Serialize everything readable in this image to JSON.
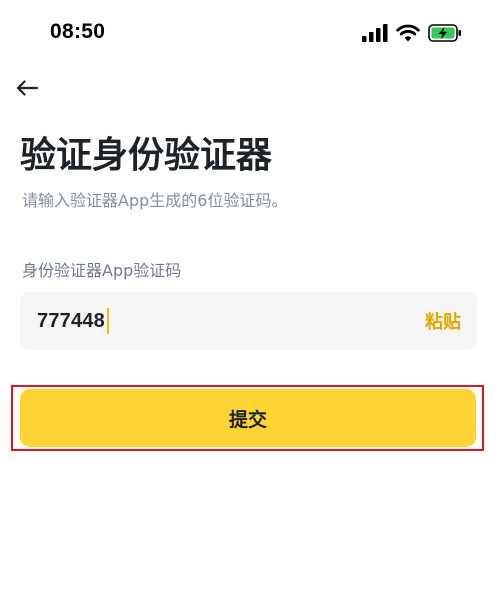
{
  "status_bar": {
    "time": "08:50",
    "icons": [
      "cellular-signal-icon",
      "wifi-icon",
      "battery-charging-icon"
    ],
    "battery_color": "#34c759"
  },
  "header": {
    "back_icon": "back-arrow-icon"
  },
  "main": {
    "title": "验证身份验证器",
    "subtitle": "请输入验证器App生成的6位验证码。",
    "field": {
      "label": "身份验证器App验证码",
      "value": "777448",
      "paste_label": "粘贴"
    },
    "submit_label": "提交"
  },
  "colors": {
    "accent": "#fcd535",
    "paste_text": "#e0a800",
    "highlight_border": "#e3161d",
    "field_background": "#f5f5f5"
  }
}
